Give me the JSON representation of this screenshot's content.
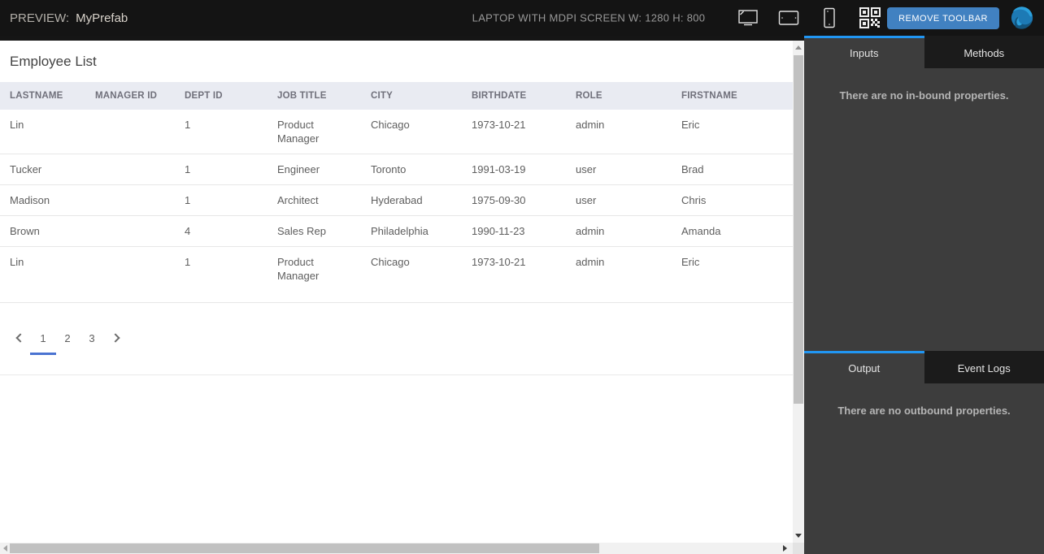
{
  "toolbar": {
    "preview_label": "PREVIEW:",
    "app_name": "MyPrefab",
    "screen_info": "LAPTOP WITH MDPI SCREEN W: 1280 H: 800",
    "remove_toolbar_label": "REMOVE TOOLBAR",
    "device_icons": [
      "laptop-icon",
      "tablet-icon",
      "mobile-icon",
      "qr-code-icon"
    ]
  },
  "main": {
    "title": "Employee List",
    "table": {
      "columns": [
        "LASTNAME",
        "MANAGER ID",
        "DEPT ID",
        "JOB TITLE",
        "CITY",
        "BIRTHDATE",
        "ROLE",
        "FIRSTNAME"
      ],
      "rows": [
        [
          "Lin",
          "",
          "1",
          "Product Manager",
          "Chicago",
          "1973-10-21",
          "admin",
          "Eric"
        ],
        [
          "Tucker",
          "",
          "1",
          "Engineer",
          "Toronto",
          "1991-03-19",
          "user",
          "Brad"
        ],
        [
          "Madison",
          "",
          "1",
          "Architect",
          "Hyderabad",
          "1975-09-30",
          "user",
          "Chris"
        ],
        [
          "Brown",
          "",
          "4",
          "Sales Rep",
          "Philadelphia",
          "1990-11-23",
          "admin",
          "Amanda"
        ],
        [
          "Lin",
          "",
          "1",
          "Product Manager",
          "Chicago",
          "1973-10-21",
          "admin",
          "Eric"
        ]
      ]
    },
    "pagination": {
      "pages": [
        "1",
        "2",
        "3"
      ],
      "active_page": "1"
    }
  },
  "side_panel": {
    "top_tabs": [
      {
        "label": "Inputs",
        "active": true
      },
      {
        "label": "Methods",
        "active": false
      }
    ],
    "inputs_empty_message": "There are no in-bound properties.",
    "bottom_tabs": [
      {
        "label": "Output",
        "active": true
      },
      {
        "label": "Event Logs",
        "active": false
      }
    ],
    "output_empty_message": "There are no outbound properties."
  },
  "colors": {
    "accent_blue": "#2196f3",
    "button_blue": "#4181c1",
    "pagination_underline": "#4a73d1",
    "table_header_bg": "#e9ebf2",
    "panel_bg": "#3d3d3d",
    "toolbar_bg": "#141414"
  }
}
